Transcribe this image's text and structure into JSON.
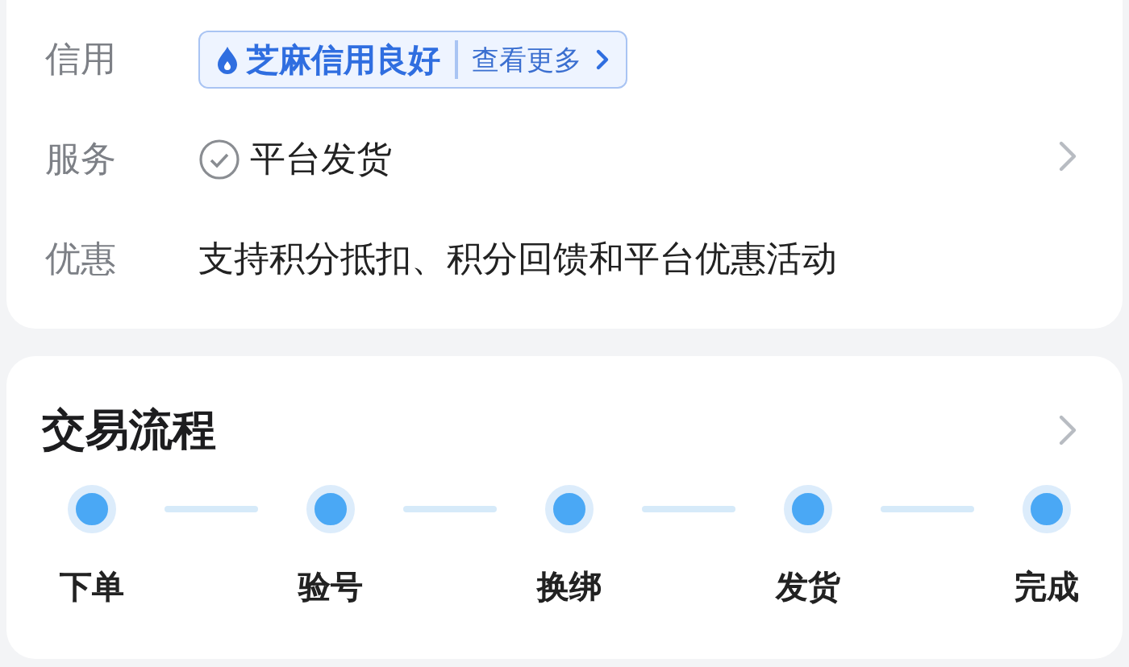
{
  "info_card": {
    "rows": [
      {
        "kind": "credit",
        "label": "信用",
        "badge": "芝麻信用良好",
        "link": "查看更多"
      },
      {
        "kind": "service",
        "label": "服务",
        "value": "平台发货",
        "has_more": true
      },
      {
        "kind": "text",
        "label": "优惠",
        "value": "支持积分抵扣、积分回馈和平台优惠活动"
      }
    ]
  },
  "process_card": {
    "title": "交易流程",
    "steps": [
      "下单",
      "验号",
      "换绑",
      "发货",
      "完成"
    ]
  }
}
